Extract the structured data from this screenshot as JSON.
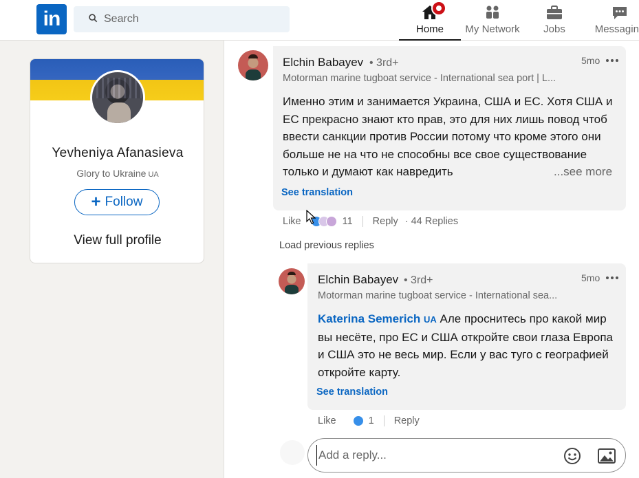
{
  "nav": {
    "search_placeholder": "Search",
    "items": [
      {
        "label": "Home",
        "icon": "home-icon"
      },
      {
        "label": "My Network",
        "icon": "network-icon"
      },
      {
        "label": "Jobs",
        "icon": "briefcase-icon"
      },
      {
        "label": "Messaging",
        "icon": "chat-icon"
      }
    ],
    "logo_text": "in"
  },
  "profile": {
    "name": "Yevheniya Afanasieva",
    "headline": "Glory to Ukraine",
    "headline_tag": "UA",
    "follow_label": "Follow",
    "view_full_profile": "View full profile"
  },
  "comment": {
    "author": "Elchin Babayev",
    "degree": "• 3rd+",
    "subtitle": "Motorman marine tugboat service - International sea port | L...",
    "time": "5mo",
    "text": "Именно этим и занимается Украина, США и ЕС. Хотя США и ЕС прекрасно знают кто прав, это для них лишь повод чтоб ввести санкции против России потому что кроме этого они больше не на что не способны все свое существование только и думают как навредить",
    "see_more": "...see more",
    "see_translation": "See translation",
    "like": "Like",
    "reaction_count": "11",
    "reply": "Reply",
    "replies": "· 44 Replies"
  },
  "load_previous": "Load previous replies",
  "reply": {
    "author": "Elchin Babayev",
    "degree": "• 3rd+",
    "subtitle": "Motorman marine tugboat service - International sea...",
    "time": "5mo",
    "mention": "Katerina Semerich",
    "mention_tag": "UA",
    "text": " Але проснитесь про какой мир вы несёте, про ЕС и США откройте свои глаза Европа и США это не весь мир. Если у вас туго с географией откройте карту.",
    "see_translation": "See translation",
    "like": "Like",
    "reaction_count": "1",
    "reply": "Reply"
  },
  "reply_box": {
    "placeholder": "Add a reply..."
  },
  "colors": {
    "brand": "#0a66c2",
    "ukraine_blue": "#2a5eb8",
    "ukraine_yellow": "#f2c515",
    "notification": "#cc1016"
  }
}
